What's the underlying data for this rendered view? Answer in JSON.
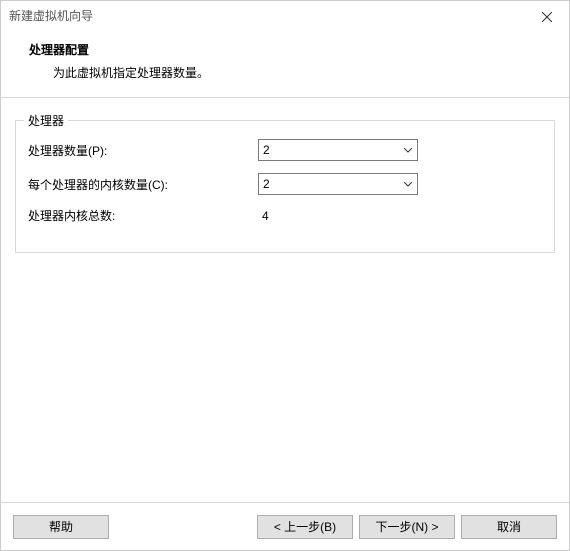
{
  "window": {
    "title": "新建虚拟机向导"
  },
  "header": {
    "title": "处理器配置",
    "subtitle": "为此虚拟机指定处理器数量。"
  },
  "group": {
    "legend": "处理器",
    "rows": {
      "processors": {
        "label": "处理器数量(P):",
        "value": "2"
      },
      "cores": {
        "label": "每个处理器的内核数量(C):",
        "value": "2"
      },
      "total": {
        "label": "处理器内核总数:",
        "value": "4"
      }
    }
  },
  "buttons": {
    "help": "帮助",
    "back": "< 上一步(B)",
    "next": "下一步(N) >",
    "cancel": "取消"
  }
}
